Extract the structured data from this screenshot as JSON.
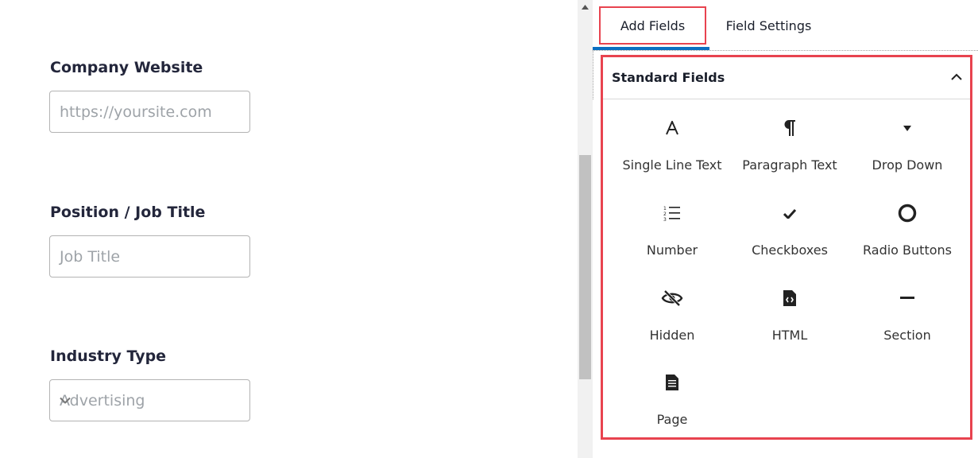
{
  "form": {
    "fields": [
      {
        "label": "Company Website",
        "placeholder": "https://yoursite.com"
      },
      {
        "label": "Position / Job Title",
        "placeholder": "Job Title"
      },
      {
        "label": "Industry Type",
        "value": "Advertising"
      }
    ]
  },
  "panel": {
    "tabs": [
      {
        "label": "Add Fields"
      },
      {
        "label": "Field Settings"
      }
    ],
    "group": {
      "title": "Standard Fields",
      "items": [
        {
          "label": "Single Line Text",
          "icon": "text-icon"
        },
        {
          "label": "Paragraph Text",
          "icon": "paragraph-icon"
        },
        {
          "label": "Drop Down",
          "icon": "caret-down-icon"
        },
        {
          "label": "Number",
          "icon": "ordered-list-icon"
        },
        {
          "label": "Checkboxes",
          "icon": "check-icon"
        },
        {
          "label": "Radio Buttons",
          "icon": "radio-icon"
        },
        {
          "label": "Hidden",
          "icon": "eye-slash-icon"
        },
        {
          "label": "HTML",
          "icon": "code-file-icon"
        },
        {
          "label": "Section",
          "icon": "minus-icon"
        },
        {
          "label": "Page",
          "icon": "page-icon"
        }
      ]
    }
  },
  "colors": {
    "highlight": "#e8434f",
    "tab_active": "#0a6fc2"
  }
}
